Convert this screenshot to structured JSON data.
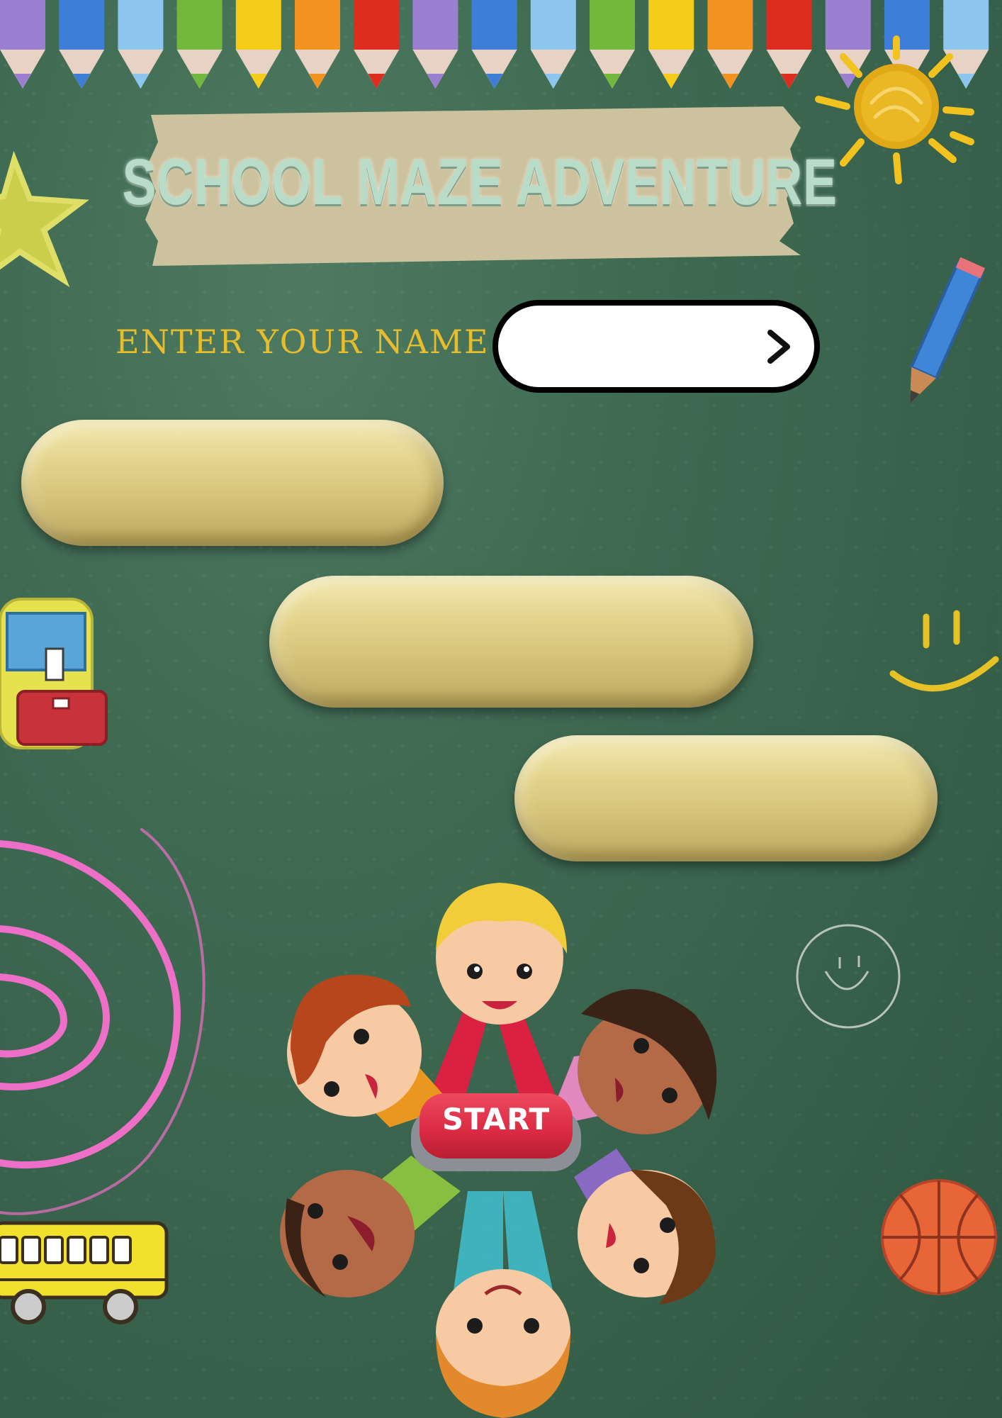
{
  "title": "SCHOOL MAZE ADVENTURE",
  "name_prompt": {
    "label": "ENTER YOUR NAME :",
    "value": "",
    "submit_icon": "chevron-right-icon"
  },
  "start_button": {
    "label": "START"
  },
  "menu_options": [
    {
      "label": ""
    },
    {
      "label": ""
    },
    {
      "label": ""
    }
  ],
  "decorations": [
    "colored-pencils",
    "sun",
    "star",
    "pencil",
    "backpack",
    "smiley",
    "spiral",
    "chalk-smiley",
    "school-bus",
    "basketball",
    "kids-circle"
  ],
  "colors": {
    "board": "#3f6a52",
    "title_text": "#b9dcc8",
    "label_text": "#e8bd2c",
    "button_gold": "#e3d28c",
    "start_red": "#d92a42"
  }
}
